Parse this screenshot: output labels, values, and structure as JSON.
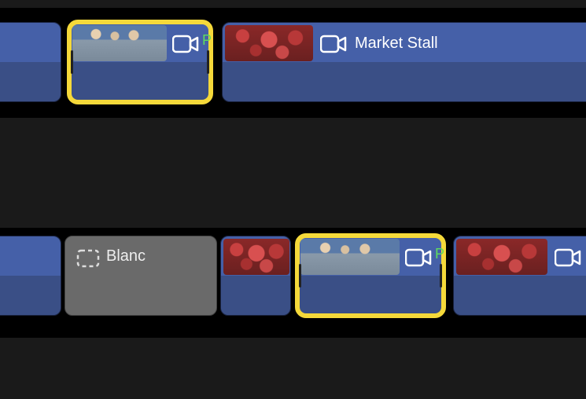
{
  "tracks": {
    "upper": {
      "clips": {
        "market_stall": {
          "label": "Market Stall"
        }
      }
    },
    "lower": {
      "clips": {
        "gap": {
          "label": "Blanc"
        }
      }
    }
  },
  "icons": {
    "camera": "camera-icon",
    "gap_box": "gap-icon"
  },
  "proxy_marker": "P"
}
